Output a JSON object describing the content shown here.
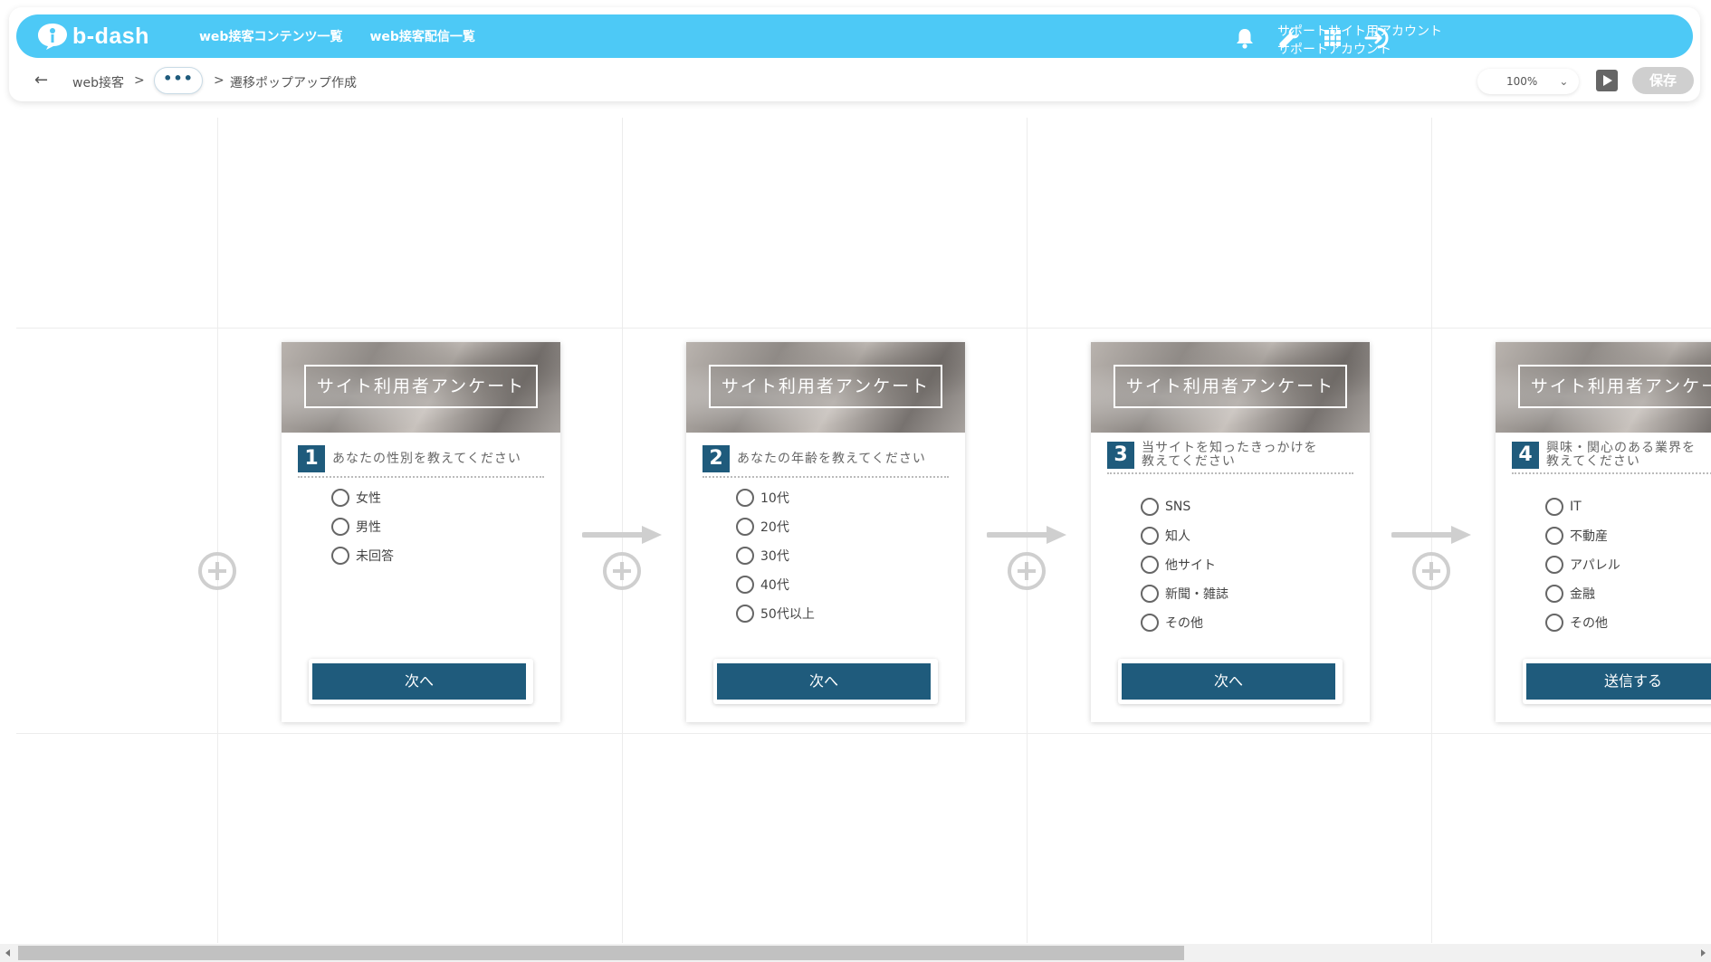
{
  "brand": {
    "name": "b-dash",
    "accent": "#4dc9f6",
    "primary": "#1f5b7c"
  },
  "nav": {
    "links": [
      "web接客コンテンツ一覧",
      "web接客配信一覧"
    ],
    "account_line1": "サポートサイト用アカウント",
    "account_line2": "サポートアカウント",
    "icons": [
      "bell-icon",
      "wrench-icon",
      "grid-icon",
      "logout-icon"
    ]
  },
  "breadcrumb": {
    "back_icon": "back-arrow-icon",
    "root": "web接客",
    "sep1": ">",
    "ellipsis": "•••",
    "sep2": ">",
    "current": "遷移ポップアップ作成"
  },
  "toolbar": {
    "zoom": "100%",
    "zoom_chevron": "⌄",
    "save_label": "保存"
  },
  "cards": [
    {
      "title": "サイト利用者アンケート",
      "num": "1",
      "question": "あなたの性別を教えてください",
      "options": [
        "女性",
        "男性",
        "未回答"
      ],
      "button": "次へ"
    },
    {
      "title": "サイト利用者アンケート",
      "num": "2",
      "question": "あなたの年齢を教えてください",
      "options": [
        "10代",
        "20代",
        "30代",
        "40代",
        "50代以上"
      ],
      "button": "次へ"
    },
    {
      "title": "サイト利用者アンケート",
      "num": "3",
      "question_l1": "当サイトを知ったきっかけを",
      "question_l2": "教えてください",
      "options": [
        "SNS",
        "知人",
        "他サイト",
        "新聞・雑誌",
        "その他"
      ],
      "button": "次へ"
    },
    {
      "title": "サイト利用者アンケート",
      "num": "4",
      "question_l1": "興味・関心のある業界を",
      "question_l2": "教えてください",
      "options": [
        "IT",
        "不動産",
        "アパレル",
        "金融",
        "その他"
      ],
      "button": "送信する"
    }
  ]
}
